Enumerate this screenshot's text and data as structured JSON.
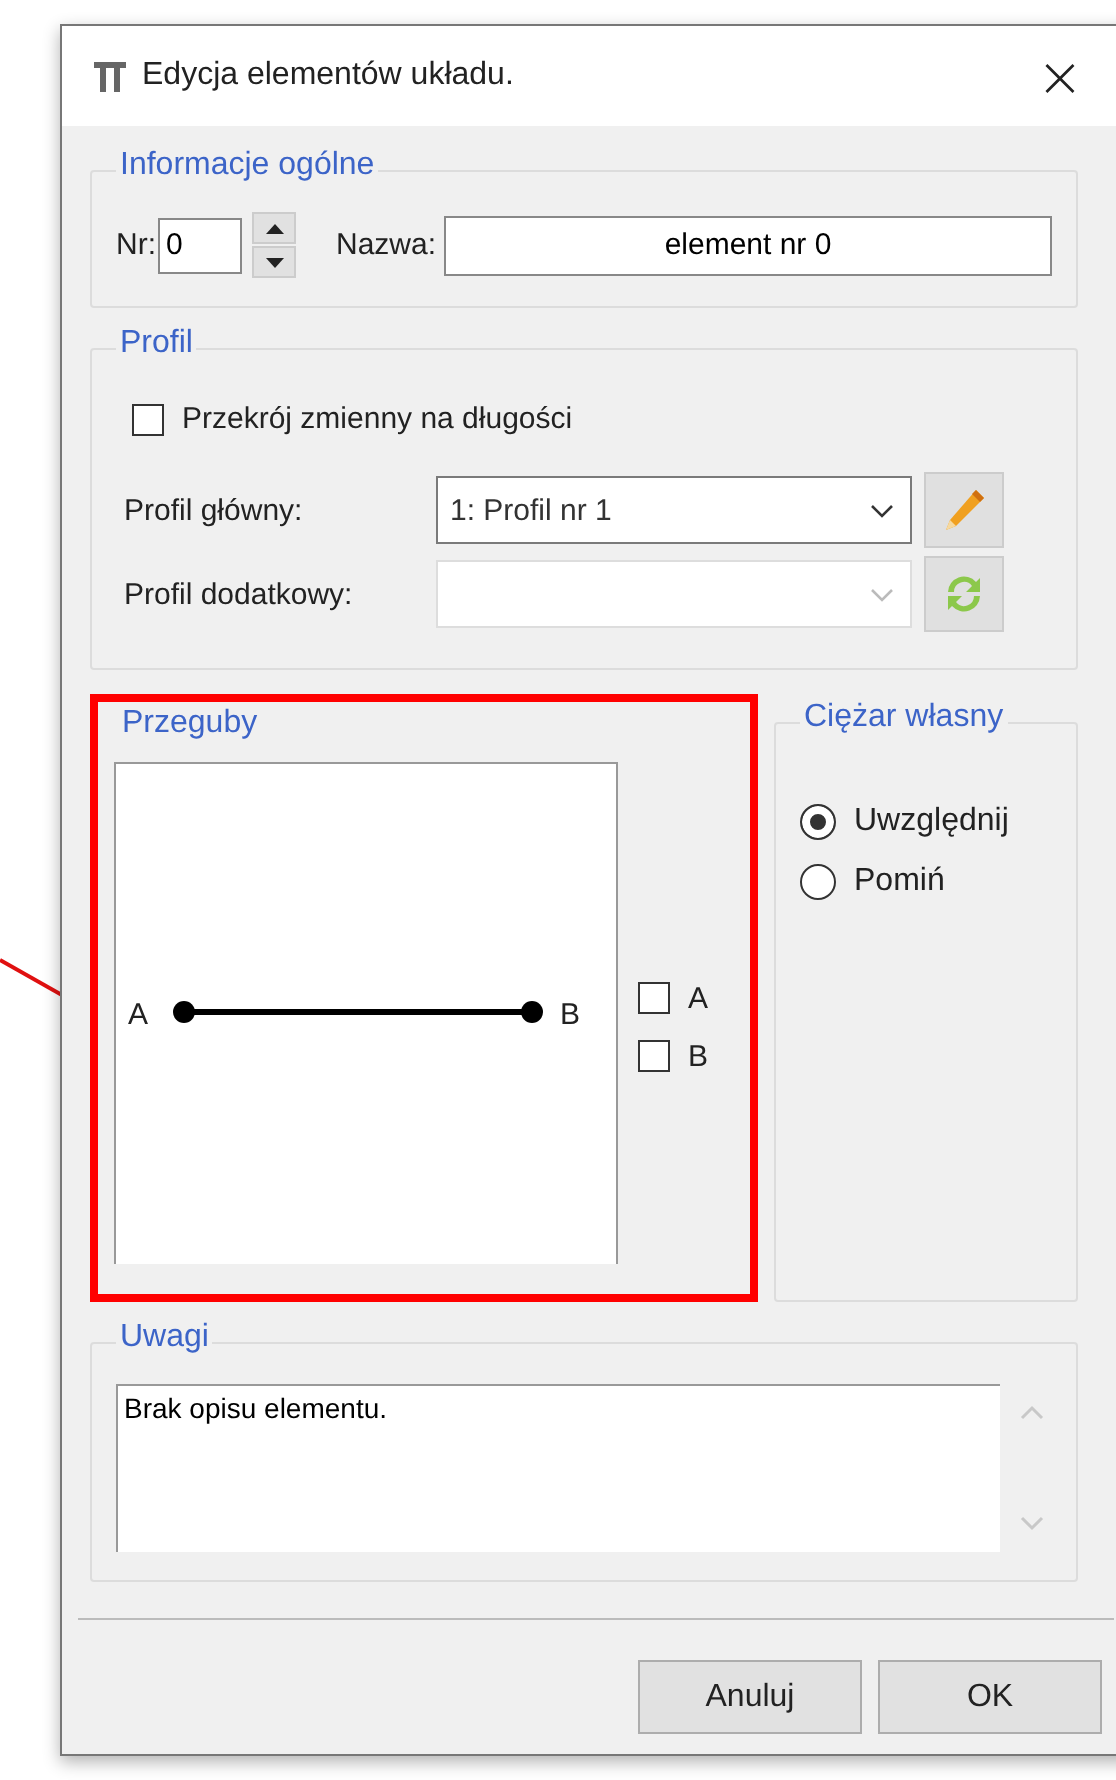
{
  "window": {
    "title": "Edycja elementów układu.",
    "close": "×"
  },
  "general": {
    "title": "Informacje ogólne",
    "nr_label": "Nr:",
    "nr_value": "0",
    "name_label": "Nazwa:",
    "name_value": "element nr 0"
  },
  "profile": {
    "title": "Profil",
    "variable": {
      "label": "Przekrój zmienny na długości",
      "checked": false
    },
    "main": {
      "label": "Profil główny:",
      "value": "1: Profil nr 1",
      "disabled": false
    },
    "extra": {
      "label": "Profil dodatkowy:",
      "disabled": true
    }
  },
  "hinges": {
    "title": "Przeguby",
    "start_label": "A",
    "end_label": "B",
    "options": [
      {
        "label": "A",
        "checked": false
      },
      {
        "label": "B",
        "checked": false
      }
    ]
  },
  "self_weight": {
    "title": "Ciężar własny",
    "options": [
      {
        "label": "Uwzględnij",
        "selected": true
      },
      {
        "label": "Pomiń",
        "selected": false
      }
    ]
  },
  "notes": {
    "title": "Uwagi",
    "value": "Brak opisu elementu."
  },
  "buttons": [
    "Anuluj",
    "OK"
  ]
}
